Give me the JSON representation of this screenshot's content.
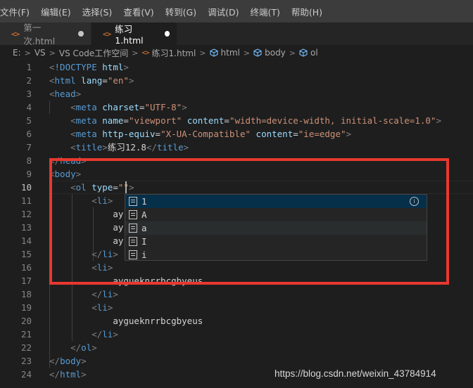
{
  "menu": [
    "文件(F)",
    "编辑(E)",
    "选择(S)",
    "查看(V)",
    "转到(G)",
    "调试(D)",
    "终端(T)",
    "帮助(H)"
  ],
  "tabs": [
    {
      "icon": "<>",
      "label": "第一次.html",
      "active": false
    },
    {
      "icon": "<>",
      "label": "练习1.html",
      "active": true
    }
  ],
  "breadcrumb": {
    "drive": "E:",
    "folder1": "VS",
    "folder2": "VS Code工作空间",
    "file": "练习1.html",
    "el1": "html",
    "el2": "body",
    "el3": "ol"
  },
  "lines": [
    {
      "n": "1",
      "html": "<span class='t-br'>&lt;</span><span class='t-tag'>!DOCTYPE</span> <span class='t-attr'>html</span><span class='t-br'>&gt;</span>"
    },
    {
      "n": "2",
      "html": "<span class='t-br'>&lt;</span><span class='t-tag'>html</span> <span class='t-attr'>lang</span><span class='t-txt'>=</span><span class='t-str'>\"en\"</span><span class='t-br'>&gt;</span>"
    },
    {
      "n": "3",
      "html": "<span class='t-br'>&lt;</span><span class='t-tag'>head</span><span class='t-br'>&gt;</span>"
    },
    {
      "n": "4",
      "html": "    <span class='t-br'>&lt;</span><span class='t-tag'>meta</span> <span class='t-attr'>charset</span><span class='t-txt'>=</span><span class='t-str'>\"UTF-8\"</span><span class='t-br'>&gt;</span>"
    },
    {
      "n": "5",
      "html": "    <span class='t-br'>&lt;</span><span class='t-tag'>meta</span> <span class='t-attr'>name</span><span class='t-txt'>=</span><span class='t-str'>\"viewport\"</span> <span class='t-attr'>content</span><span class='t-txt'>=</span><span class='t-str'>\"width=device-width, initial-scale=1.0\"</span><span class='t-br'>&gt;</span>"
    },
    {
      "n": "6",
      "html": "    <span class='t-br'>&lt;</span><span class='t-tag'>meta</span> <span class='t-attr'>http-equiv</span><span class='t-txt'>=</span><span class='t-str'>\"X-UA-Compatible\"</span> <span class='t-attr'>content</span><span class='t-txt'>=</span><span class='t-str'>\"ie=edge\"</span><span class='t-br'>&gt;</span>"
    },
    {
      "n": "7",
      "html": "    <span class='t-br'>&lt;</span><span class='t-tag'>title</span><span class='t-br'>&gt;</span><span class='t-txt'>练习12.8</span><span class='t-br'>&lt;/</span><span class='t-tag'>title</span><span class='t-br'>&gt;</span>"
    },
    {
      "n": "8",
      "html": "<span class='t-br'>&lt;/</span><span class='t-tag'>head</span><span class='t-br'>&gt;</span>"
    },
    {
      "n": "9",
      "html": "<span class='t-br'>&lt;</span><span class='t-tag'>body</span><span class='t-br'>&gt;</span>"
    },
    {
      "n": "10",
      "html": "    <span class='t-br'>&lt;</span><span class='t-tag'>ol</span> <span class='t-attr'>type</span><span class='t-txt'>=</span><span class='t-str'>\"\"</span><span class='t-br'>&gt;</span>"
    },
    {
      "n": "11",
      "html": "        <span class='t-br'>&lt;</span><span class='t-tag'>li</span><span class='t-br'>&gt;</span>"
    },
    {
      "n": "12",
      "html": "            <span class='t-txt'>ay</span>"
    },
    {
      "n": "13",
      "html": "            <span class='t-txt'>ay</span>"
    },
    {
      "n": "14",
      "html": "            <span class='t-txt'>ay</span>"
    },
    {
      "n": "15",
      "html": "        <span class='t-br'>&lt;/</span><span class='t-tag'>li</span><span class='t-br'>&gt;</span>"
    },
    {
      "n": "16",
      "html": "        <span class='t-br'>&lt;</span><span class='t-tag'>li</span><span class='t-br'>&gt;</span>"
    },
    {
      "n": "17",
      "html": "            <span class='t-txt'>aygueknrrbcgbyeus</span>"
    },
    {
      "n": "18",
      "html": "        <span class='t-br'>&lt;/</span><span class='t-tag'>li</span><span class='t-br'>&gt;</span>"
    },
    {
      "n": "19",
      "html": "        <span class='t-br'>&lt;</span><span class='t-tag'>li</span><span class='t-br'>&gt;</span>"
    },
    {
      "n": "20",
      "html": "            <span class='t-txt'>aygueknrrbcgbyeus</span>"
    },
    {
      "n": "21",
      "html": "        <span class='t-br'>&lt;/</span><span class='t-tag'>li</span><span class='t-br'>&gt;</span>"
    },
    {
      "n": "22",
      "html": "    <span class='t-br'>&lt;/</span><span class='t-tag'>ol</span><span class='t-br'>&gt;</span>"
    },
    {
      "n": "23",
      "html": "<span class='t-br'>&lt;/</span><span class='t-tag'>body</span><span class='t-br'>&gt;</span>"
    },
    {
      "n": "24",
      "html": "<span class='t-br'>&lt;/</span><span class='t-tag'>html</span><span class='t-br'>&gt;</span>"
    }
  ],
  "suggestions": [
    "1",
    "A",
    "a",
    "I",
    "i"
  ],
  "watermark": "https://blog.csdn.net/weixin_43784914",
  "colors": {
    "tag": "#569cd6",
    "attr": "#9cdcfe",
    "string": "#ce9178",
    "highlight": "#e8382f"
  }
}
